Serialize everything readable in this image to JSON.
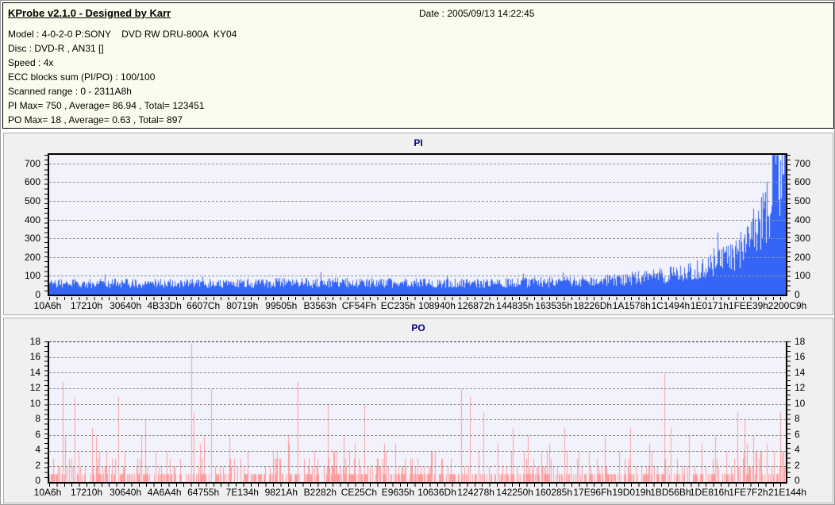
{
  "header": {
    "title": "KProbe v2.1.0 - Designed by Karr",
    "date_label": "Date : 2005/09/13 14:22:45",
    "lines": [
      "Model : 4-0-2-0 P:SONY    DVD RW DRU-800A  KY04",
      "Disc : DVD-R , AN31 []",
      "Speed : 4x",
      "ECC blocks sum (PI/PO) : 100/100",
      "Scanned range : 0 - 2311A8h",
      "PI Max= 750 , Average= 86.94 , Total= 123451",
      "PO Max= 18 , Average= 0.63 , Total= 897"
    ]
  },
  "colors": {
    "header_bg": "#FCFCEE",
    "panel_bg": "#F0F0F0",
    "plot_bg": "#F2F2FC",
    "grid": "#8F8F8F",
    "title_navy": "#000080",
    "pi_bar": "#3565F6",
    "po_bar": "#FF9C9C"
  },
  "chart_data": [
    {
      "type": "bar",
      "title": "PI",
      "xlabel": "",
      "ylabel": "",
      "grid": true,
      "legend": "none",
      "bar_color": "#3565F6",
      "ylim": [
        0,
        745
      ],
      "yticks": [
        0,
        100,
        200,
        300,
        400,
        500,
        600,
        700
      ],
      "x_labels": [
        "10A6h",
        "17210h",
        "30640h",
        "4B33Dh",
        "6607Ch",
        "80719h",
        "99505h",
        "B3563h",
        "CF54Fh",
        "EC235h",
        "108940h",
        "126872h",
        "144835h",
        "163535h",
        "18226Dh",
        "1A1578h",
        "1C1494h",
        "1E0171h",
        "1FEE39h",
        "2200C9h"
      ],
      "stats": {
        "max": 750,
        "average": 86.94,
        "total": 123451
      },
      "n_points": 928,
      "seed": 20050913,
      "noise_low": 0.6,
      "noise_span": 0.9,
      "trend": [
        [
          0,
          58
        ],
        [
          0.1,
          56
        ],
        [
          0.2,
          57
        ],
        [
          0.3,
          58
        ],
        [
          0.4,
          60
        ],
        [
          0.5,
          58
        ],
        [
          0.55,
          57
        ],
        [
          0.62,
          60
        ],
        [
          0.68,
          64
        ],
        [
          0.72,
          66
        ],
        [
          0.75,
          72
        ],
        [
          0.8,
          84
        ],
        [
          0.84,
          98
        ],
        [
          0.87,
          115
        ],
        [
          0.9,
          145
        ],
        [
          0.92,
          185
        ],
        [
          0.94,
          235
        ],
        [
          0.955,
          300
        ],
        [
          0.97,
          400
        ],
        [
          0.98,
          480
        ],
        [
          0.99,
          620
        ],
        [
          1,
          600
        ]
      ],
      "spikes": [
        [
          0.903,
          250
        ],
        [
          0.908,
          330
        ],
        [
          0.975,
          600
        ],
        [
          0.984,
          750
        ],
        [
          0.987,
          700
        ],
        [
          0.993,
          715
        ],
        [
          0.997,
          640
        ]
      ]
    },
    {
      "type": "bar",
      "title": "PO",
      "xlabel": "",
      "ylabel": "",
      "grid": true,
      "legend": "none",
      "bar_color": "#FF9C9C",
      "ylim": [
        0,
        18
      ],
      "yticks": [
        0,
        2,
        4,
        6,
        8,
        10,
        12,
        14,
        16,
        18
      ],
      "x_labels": [
        "10A6h",
        "17210h",
        "30640h",
        "4A6A4h",
        "64755h",
        "7E134h",
        "9821Ah",
        "B2282h",
        "CE25Ch",
        "E9635h",
        "10636Dh",
        "124278h",
        "142250h",
        "160285h",
        "17E96Fh",
        "19D019h",
        "1BD56Bh",
        "1DE816h",
        "1FE7F2h",
        "21E144h"
      ],
      "stats": {
        "max": 18,
        "average": 0.63,
        "total": 897
      },
      "n_points": 928,
      "seed": 897,
      "sparse": true,
      "spikes": [
        [
          0.018,
          13
        ],
        [
          0.022,
          6
        ],
        [
          0.035,
          11
        ],
        [
          0.04,
          4
        ],
        [
          0.058,
          7
        ],
        [
          0.064,
          6
        ],
        [
          0.094,
          11
        ],
        [
          0.125,
          6
        ],
        [
          0.131,
          8
        ],
        [
          0.145,
          4
        ],
        [
          0.16,
          4
        ],
        [
          0.193,
          18
        ],
        [
          0.196,
          9
        ],
        [
          0.205,
          5
        ],
        [
          0.22,
          12
        ],
        [
          0.245,
          6
        ],
        [
          0.26,
          3
        ],
        [
          0.31,
          3
        ],
        [
          0.325,
          6
        ],
        [
          0.338,
          13
        ],
        [
          0.36,
          4
        ],
        [
          0.379,
          10
        ],
        [
          0.4,
          6
        ],
        [
          0.415,
          4
        ],
        [
          0.428,
          10
        ],
        [
          0.455,
          5
        ],
        [
          0.47,
          5
        ],
        [
          0.5,
          3
        ],
        [
          0.52,
          4
        ],
        [
          0.56,
          12
        ],
        [
          0.572,
          11
        ],
        [
          0.59,
          9
        ],
        [
          0.61,
          5
        ],
        [
          0.63,
          7
        ],
        [
          0.65,
          6
        ],
        [
          0.68,
          5
        ],
        [
          0.7,
          7
        ],
        [
          0.72,
          4
        ],
        [
          0.755,
          6
        ],
        [
          0.775,
          4
        ],
        [
          0.79,
          7
        ],
        [
          0.815,
          5
        ],
        [
          0.836,
          14
        ],
        [
          0.845,
          7
        ],
        [
          0.87,
          6
        ],
        [
          0.887,
          5
        ],
        [
          0.905,
          6
        ],
        [
          0.92,
          4
        ],
        [
          0.935,
          9
        ],
        [
          0.945,
          8
        ],
        [
          0.957,
          6
        ],
        [
          0.968,
          4
        ],
        [
          0.975,
          5
        ],
        [
          0.985,
          4
        ],
        [
          0.993,
          9
        ]
      ]
    }
  ]
}
